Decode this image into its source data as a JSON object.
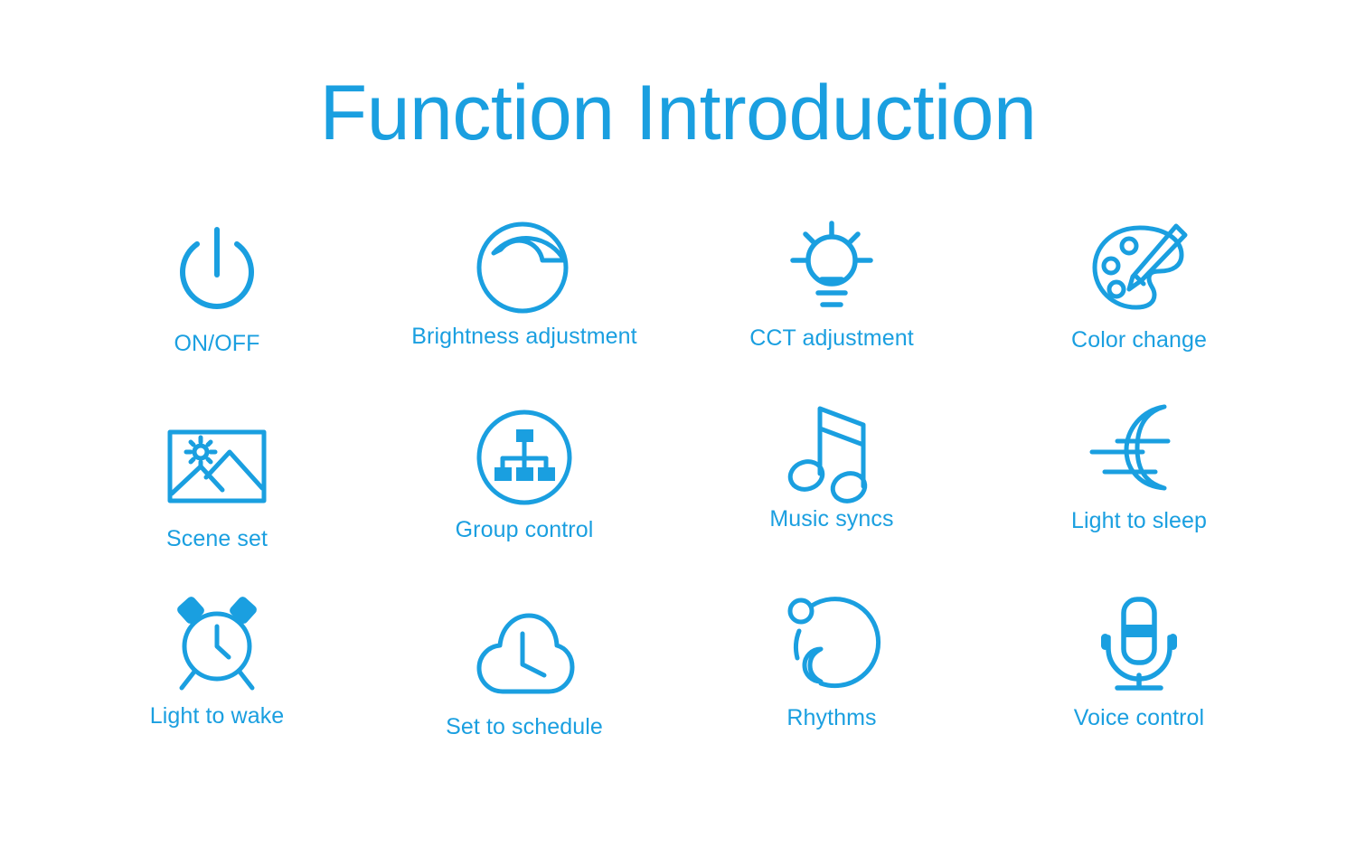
{
  "page": {
    "title": "Function Introduction",
    "background_color": "#ffffff",
    "accent_color": "#1A9FE0"
  },
  "grid": {
    "columns": 4,
    "rows": 3
  },
  "features": [
    {
      "label": "ON/OFF",
      "icon": "power-icon",
      "row": 1,
      "column": 1
    },
    {
      "label": "Brightness adjustment",
      "icon": "brightness-dial-icon",
      "row": 1,
      "column": 2
    },
    {
      "label": "CCT adjustment",
      "icon": "light-bulb-icon",
      "row": 1,
      "column": 3
    },
    {
      "label": "Color change",
      "icon": "palette-brush-icon",
      "row": 1,
      "column": 4
    },
    {
      "label": "Scene set",
      "icon": "landscape-picture-icon",
      "row": 2,
      "column": 1
    },
    {
      "label": "Group control",
      "icon": "hierarchy-circle-icon",
      "row": 2,
      "column": 2
    },
    {
      "label": "Music syncs",
      "icon": "music-note-icon",
      "row": 2,
      "column": 3
    },
    {
      "label": "Light to sleep",
      "icon": "crescent-moon-icon",
      "row": 2,
      "column": 4
    },
    {
      "label": "Light to wake",
      "icon": "alarm-clock-icon",
      "row": 3,
      "column": 1
    },
    {
      "label": "Set to schedule",
      "icon": "cloud-clock-icon",
      "row": 3,
      "column": 2
    },
    {
      "label": "Rhythms",
      "icon": "circadian-cycle-icon",
      "row": 3,
      "column": 3
    },
    {
      "label": "Voice control",
      "icon": "microphone-icon",
      "row": 3,
      "column": 4
    }
  ]
}
